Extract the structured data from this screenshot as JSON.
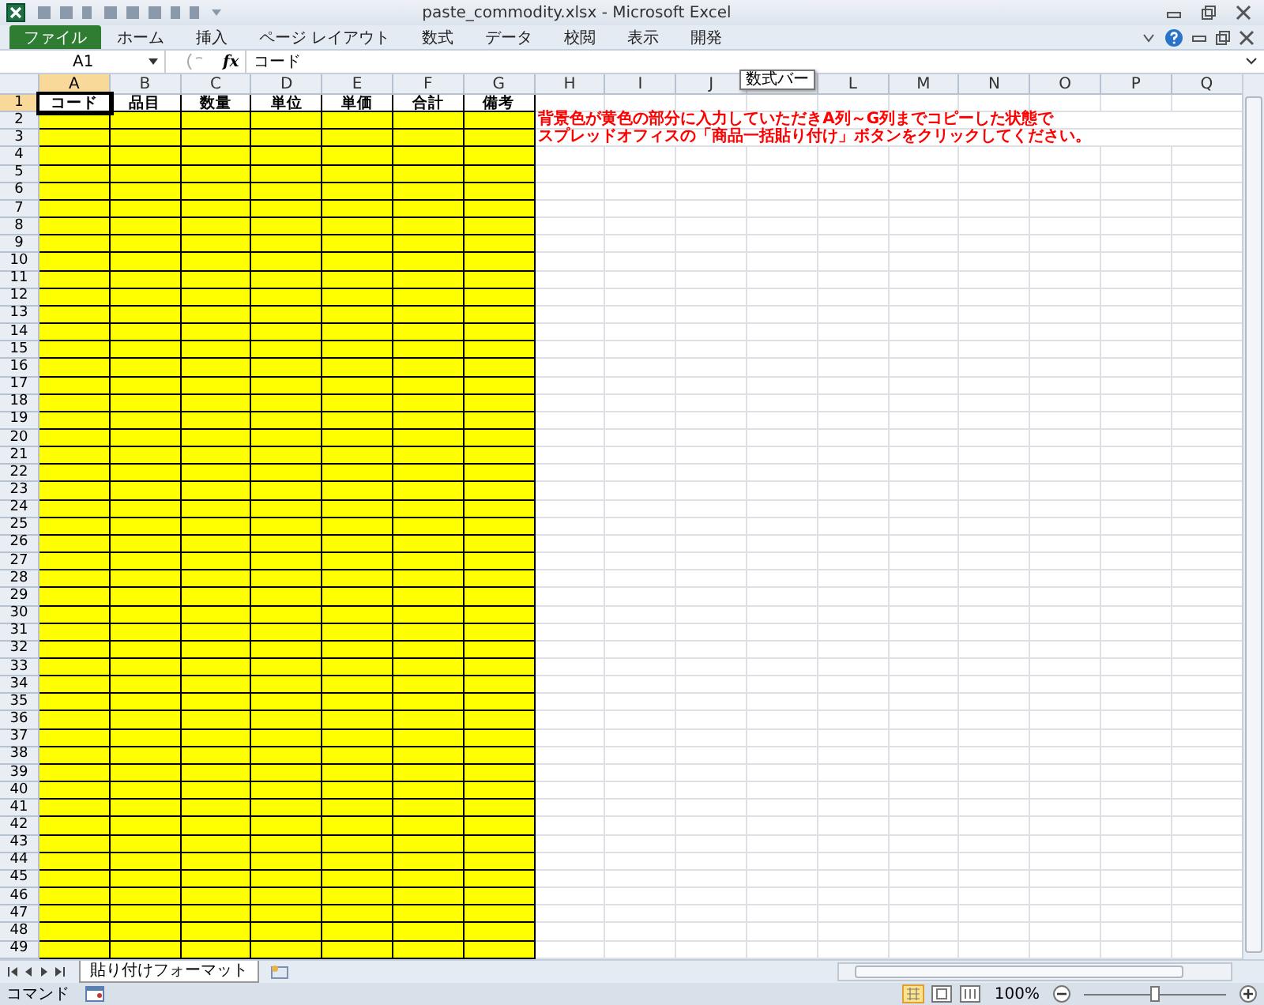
{
  "window": {
    "title": "paste_commodity.xlsx - Microsoft Excel"
  },
  "ribbon_tabs": [
    {
      "label": "ファイル",
      "kind": "file"
    },
    {
      "label": "ホーム",
      "kind": "tab"
    },
    {
      "label": "挿入",
      "kind": "tab"
    },
    {
      "label": "ページ レイアウト",
      "kind": "tab"
    },
    {
      "label": "数式",
      "kind": "tab"
    },
    {
      "label": "データ",
      "kind": "tab"
    },
    {
      "label": "校閲",
      "kind": "tab"
    },
    {
      "label": "表示",
      "kind": "tab"
    },
    {
      "label": "開発",
      "kind": "tab"
    }
  ],
  "formula_bar": {
    "name_box": "A1",
    "fx": "fx",
    "value": "コード",
    "tooltip": "数式バー"
  },
  "columns": [
    {
      "label": "A",
      "selected": true,
      "color": "#ffff00"
    },
    {
      "label": "B",
      "selected": false,
      "color": "#ffff00"
    },
    {
      "label": "C",
      "selected": false,
      "color": "#ffff00"
    },
    {
      "label": "D",
      "selected": false,
      "color": "#ffff00"
    },
    {
      "label": "E",
      "selected": false,
      "color": "#ffff00"
    },
    {
      "label": "F",
      "selected": false,
      "color": "#ffff00"
    },
    {
      "label": "G",
      "selected": false,
      "color": "#ffff00"
    },
    {
      "label": "H",
      "selected": false
    },
    {
      "label": "I",
      "selected": false
    },
    {
      "label": "J",
      "selected": false
    },
    {
      "selected": false
    },
    {
      "label": "L",
      "selected": false
    },
    {
      "label": "M",
      "selected": false
    },
    {
      "label": "N",
      "selected": false
    },
    {
      "label": "O",
      "selected": false
    },
    {
      "label": "P",
      "selected": false
    },
    {
      "label": "Q",
      "selected": false
    }
  ],
  "header_row": [
    "コード",
    "品目",
    "数量",
    "単位",
    "単価",
    "合計",
    "備考"
  ],
  "notes": [
    "背景色が黄色の部分に入力していただきA列～G列までコピーした状態で",
    "スプレッドオフィスの「商品一括貼り付け」ボタンをクリックしてください。"
  ],
  "row_labels": [
    "1",
    "2",
    "3",
    "4",
    "5",
    "6",
    "7",
    "8",
    "9",
    "10",
    "11",
    "12",
    "13",
    "14",
    "15",
    "16",
    "17",
    "18",
    "19",
    "20",
    "21",
    "22",
    "23",
    "24",
    "25",
    "26",
    "27",
    "28",
    "29",
    "30",
    "31",
    "32",
    "33",
    "34",
    "35",
    "36",
    "37",
    "38",
    "39",
    "40",
    "41",
    "42",
    "43",
    "44",
    "45",
    "46",
    "47",
    "48",
    "49"
  ],
  "sheet_tabs": [
    {
      "label": "貼り付けフォーマット",
      "selected": true
    }
  ],
  "status_bar": {
    "mode": "コマンド",
    "zoom": "100%",
    "level": 0.5
  }
}
